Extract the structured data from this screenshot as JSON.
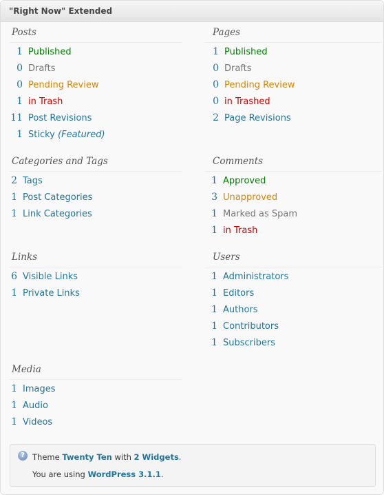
{
  "widget": {
    "title": "\"Right Now\" Extended"
  },
  "posts": {
    "heading": "Posts",
    "items": [
      {
        "count": "1",
        "label": "Published"
      },
      {
        "count": "0",
        "label": "Drafts"
      },
      {
        "count": "0",
        "label": "Pending Review"
      },
      {
        "count": "1",
        "label": "in Trash"
      },
      {
        "count": "11",
        "label": "Post Revisions"
      },
      {
        "count": "1",
        "label": "Sticky",
        "extra": "(Featured)"
      }
    ]
  },
  "pages": {
    "heading": "Pages",
    "items": [
      {
        "count": "1",
        "label": "Published"
      },
      {
        "count": "0",
        "label": "Drafts"
      },
      {
        "count": "0",
        "label": "Pending Review"
      },
      {
        "count": "0",
        "label": "in Trashed"
      },
      {
        "count": "2",
        "label": "Page Revisions"
      }
    ]
  },
  "categories": {
    "heading": "Categories and Tags",
    "items": [
      {
        "count": "2",
        "label": "Tags"
      },
      {
        "count": "1",
        "label": "Post Categories"
      },
      {
        "count": "1",
        "label": "Link Categories"
      }
    ]
  },
  "comments": {
    "heading": "Comments",
    "items": [
      {
        "count": "1",
        "label": "Approved"
      },
      {
        "count": "3",
        "label": "Unapproved"
      },
      {
        "count": "1",
        "label": "Marked as Spam"
      },
      {
        "count": "1",
        "label": "in Trash"
      }
    ]
  },
  "links": {
    "heading": "Links",
    "items": [
      {
        "count": "6",
        "label": "Visible Links"
      },
      {
        "count": "1",
        "label": "Private Links"
      }
    ]
  },
  "users": {
    "heading": "Users",
    "items": [
      {
        "count": "1",
        "label": "Administrators"
      },
      {
        "count": "1",
        "label": "Editors"
      },
      {
        "count": "1",
        "label": "Authors"
      },
      {
        "count": "1",
        "label": "Contributors"
      },
      {
        "count": "1",
        "label": "Subscribers"
      }
    ]
  },
  "media": {
    "heading": "Media",
    "items": [
      {
        "count": "1",
        "label": "Images"
      },
      {
        "count": "1",
        "label": "Audio"
      },
      {
        "count": "1",
        "label": "Videos"
      }
    ]
  },
  "theme": {
    "prefix": "Theme",
    "theme_name": "Twenty Ten",
    "with": "with",
    "widgets": "2 Widgets",
    "end": ".",
    "using_prefix": "You are using",
    "wp_version": "WordPress 3.1.1",
    "using_end": "."
  },
  "colors": {
    "link": "#21759b",
    "approved": "#008000",
    "pending": "#d98500",
    "trash": "#cc0000",
    "muted": "#777777"
  },
  "icons": {
    "info": "info-icon"
  }
}
